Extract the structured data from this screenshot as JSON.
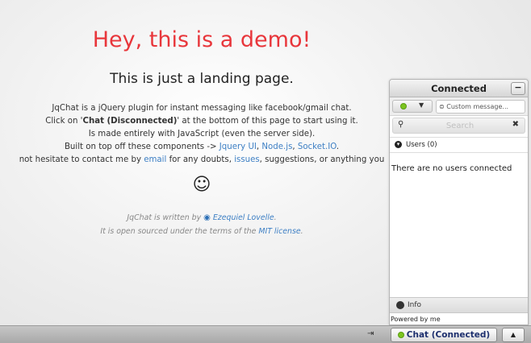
{
  "landing": {
    "headline": "Hey, this is a demo!",
    "subhead": "This is just a landing page.",
    "desc": {
      "line1": "JqChat is a jQuery plugin for instant messaging like facebook/gmail chat.",
      "line2_pre": "Click on '",
      "line2_bold": "Chat (Disconnected)",
      "line2_post": "' at the bottom of this page to start using it.",
      "line3": "Is made entirely with JavaScript (even the server side).",
      "line4_pre": "Built on top off these components -> ",
      "link_jqueryui": "Jquery UI",
      "link_node": "Node.js",
      "link_socket": "Socket.IO",
      "line5_pre": "not hesitate to contact me by ",
      "link_email": "email",
      "line5_mid": " for any doubts, ",
      "link_issues": "issues",
      "line5_post": ", suggestions, or anything you"
    },
    "smiley": "☺",
    "credits": {
      "line1_pre": "JqChat is written by ",
      "author": "Ezequiel Lovelle",
      "line2_pre": "It is open sourced under the terms of the ",
      "license": "MIT license"
    }
  },
  "chat_panel": {
    "title": "Connected",
    "minimize_label": "−",
    "custom_message_placeholder": "Custom message...",
    "search_placeholder": "Search",
    "users_label": "Users (0)",
    "empty_text": "There are no users connected",
    "info_label": "Info",
    "powered_by": "Powered by me"
  },
  "bottom_bar": {
    "chat_button_label": "Chat (Connected)",
    "collapse_label": "⇥",
    "expand_label": "▲"
  },
  "colors": {
    "headline": "#e8363b",
    "link": "#3d7fc4",
    "status_online": "#7cc41f"
  }
}
